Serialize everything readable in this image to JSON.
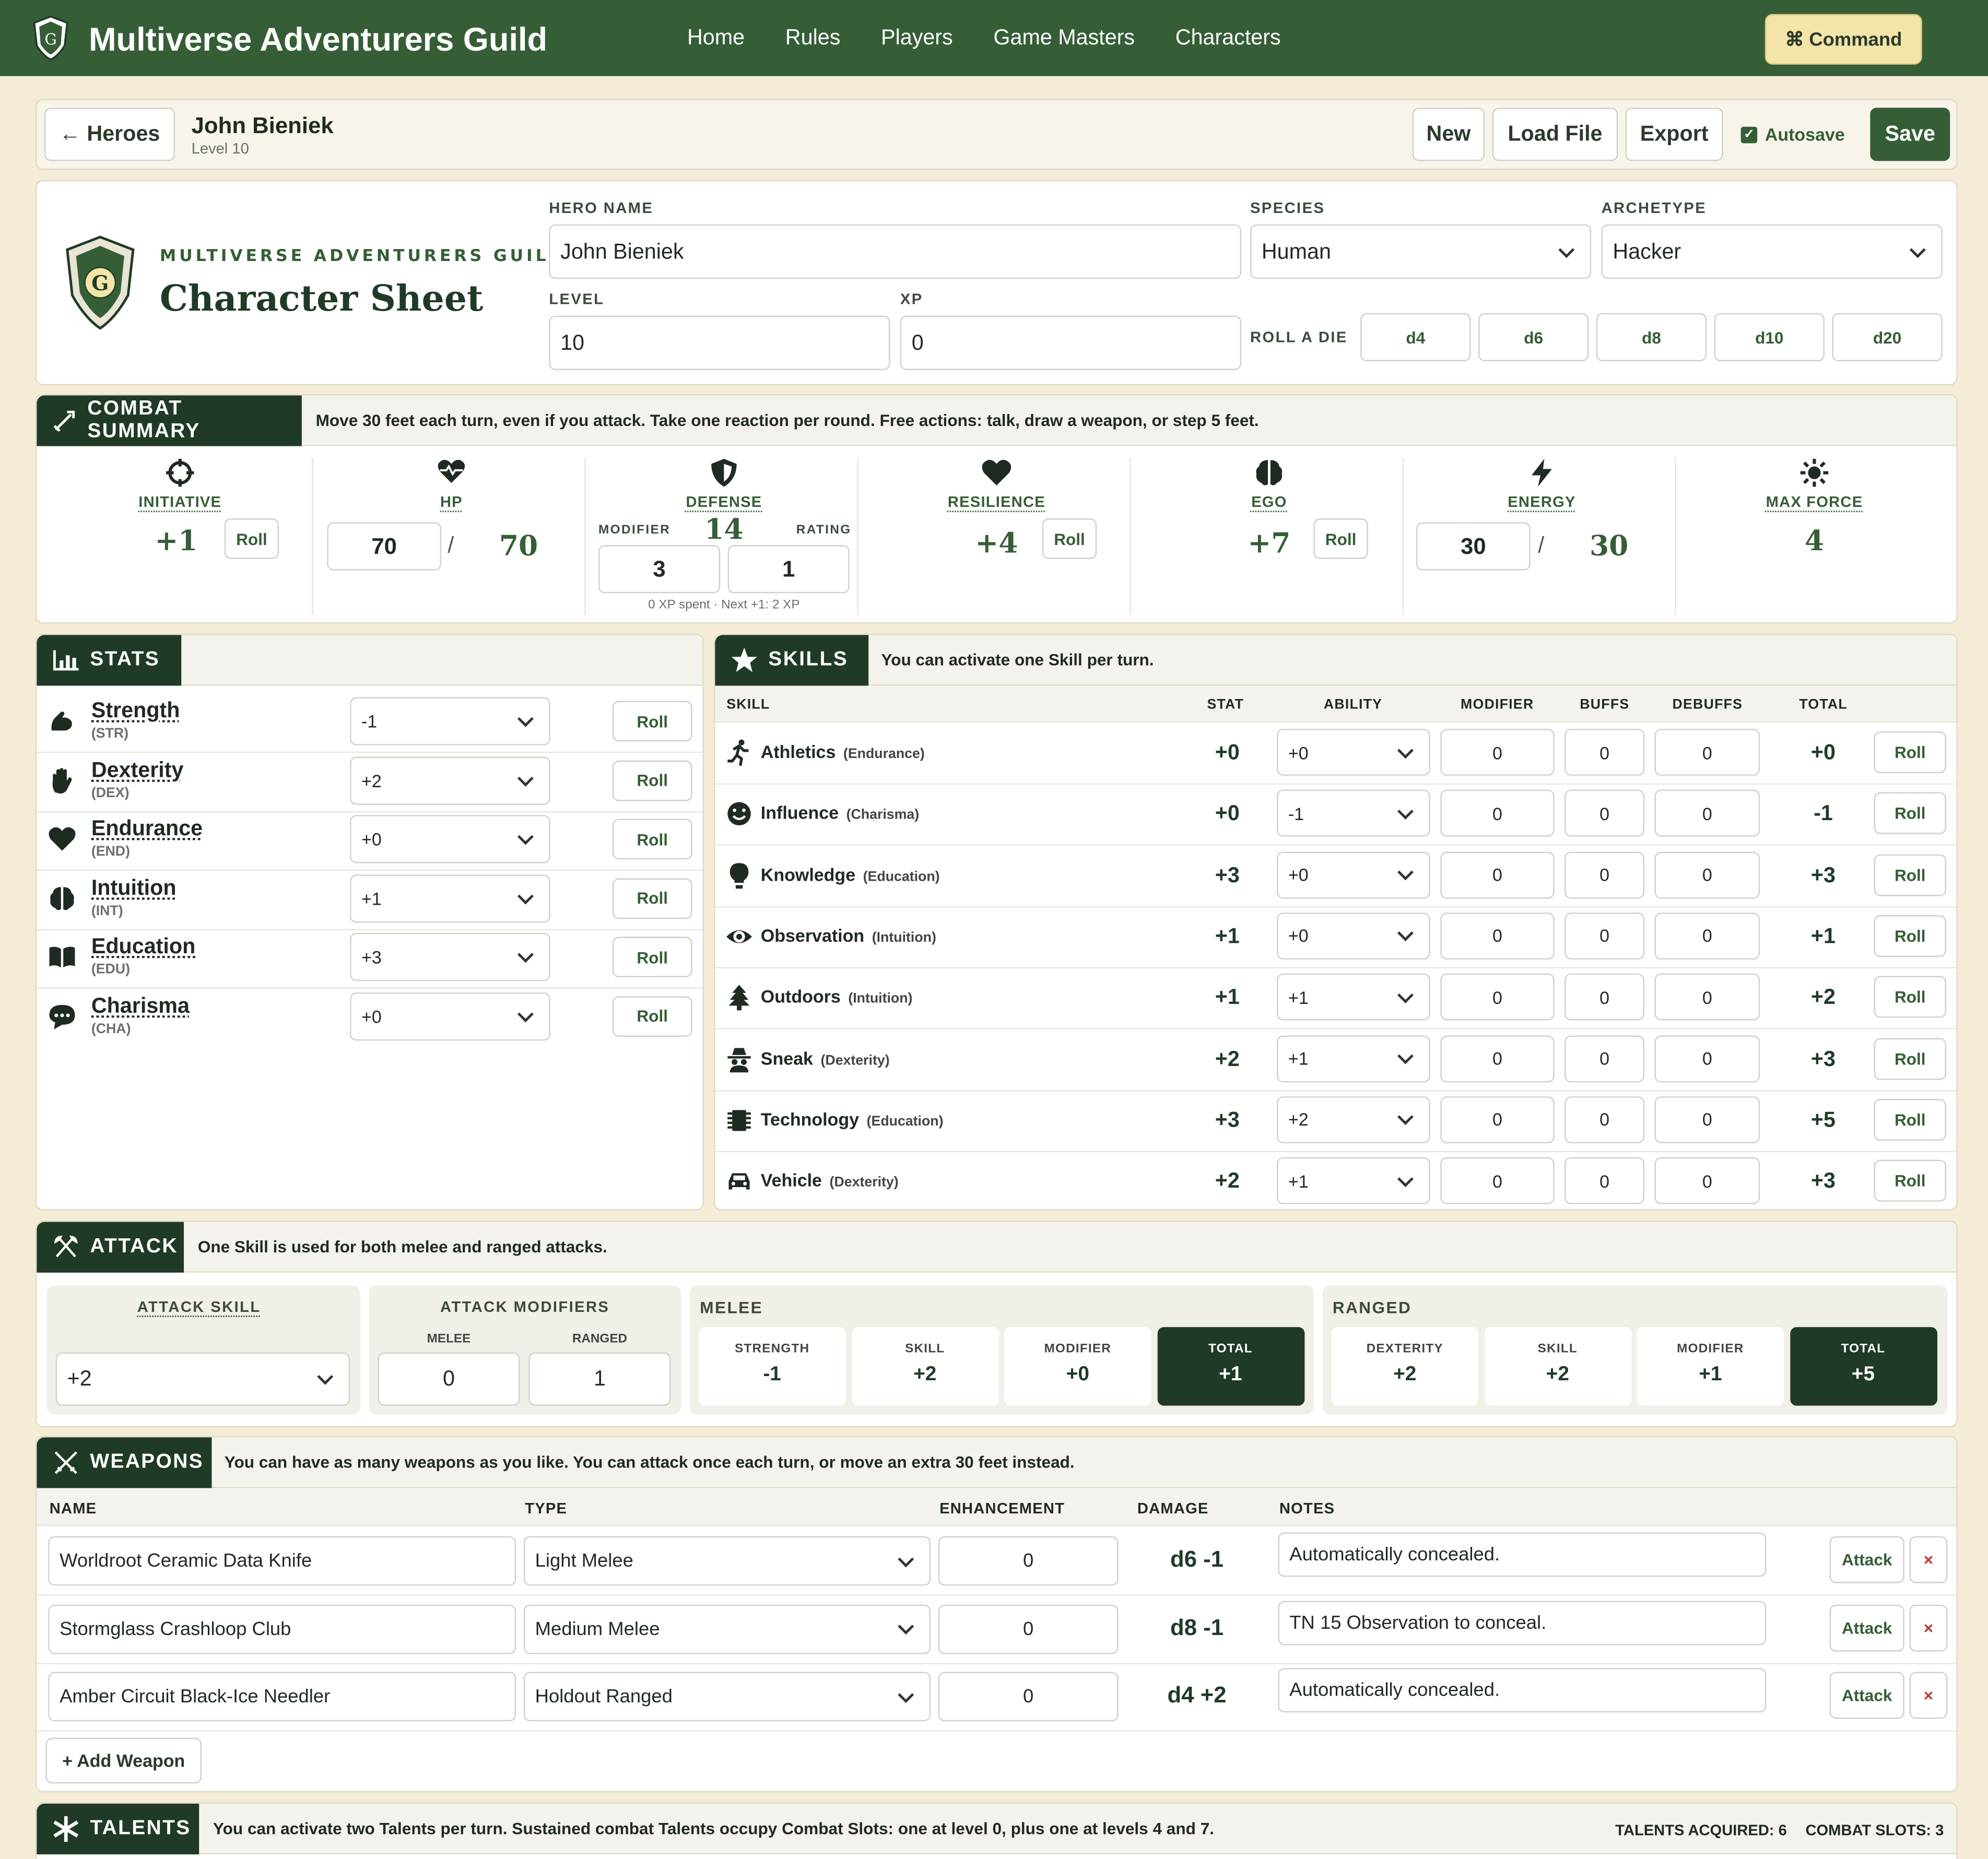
{
  "nav": {
    "brand": "Multiverse Adventurers Guild",
    "links": [
      "Home",
      "Rules",
      "Players",
      "Game Masters",
      "Characters"
    ],
    "command": "Command",
    "colors": {
      "primary": "#355e36",
      "dark": "#1f3b27",
      "background": "#f5ecd7"
    }
  },
  "header": {
    "back": "← Heroes",
    "name": "John Bieniek",
    "level": "Level 10",
    "new": "New",
    "load": "Load File",
    "export": "Export",
    "autosave": "Autosave",
    "save": "Save"
  },
  "sheet": {
    "guild": "MULTIVERSE ADVENTURERS GUILD",
    "title": "Character Sheet",
    "labels": {
      "hero_name": "HERO NAME",
      "species": "SPECIES",
      "archetype": "ARCHETYPE",
      "level": "LEVEL",
      "xp": "XP",
      "roll_die": "ROLL A DIE"
    },
    "hero_name": "John Bieniek",
    "species": "Human",
    "archetype": "Hacker",
    "level": "10",
    "xp": "0",
    "dice": [
      "d4",
      "d6",
      "d8",
      "d10",
      "d20"
    ]
  },
  "combat": {
    "title": "COMBAT SUMMARY",
    "note": "Move 30 feet each turn, even if you attack. Take one reaction per round. Free actions: talk, draw a weapon, or step 5 feet.",
    "roll": "Roll",
    "initiative": {
      "label": "INITIATIVE",
      "value": "+1"
    },
    "hp": {
      "label": "HP",
      "current": "70",
      "max": "70",
      "sep": "/"
    },
    "defense": {
      "label": "DEFENSE",
      "value": "14",
      "modifier_label": "MODIFIER",
      "rating_label": "RATING",
      "modifier": "3",
      "rating": "1",
      "note": "0 XP spent · Next +1: 2 XP"
    },
    "resilience": {
      "label": "RESILIENCE",
      "value": "+4"
    },
    "ego": {
      "label": "EGO",
      "value": "+7"
    },
    "energy": {
      "label": "ENERGY",
      "current": "30",
      "max": "30",
      "sep": "/"
    },
    "max_force": {
      "label": "MAX FORCE",
      "value": "4"
    }
  },
  "stats": {
    "title": "STATS",
    "roll": "Roll",
    "items": [
      {
        "name": "Strength",
        "abbr": "(STR)",
        "value": "-1",
        "icon": "flexed-arm-icon"
      },
      {
        "name": "Dexterity",
        "abbr": "(DEX)",
        "value": "+2",
        "icon": "hand-icon"
      },
      {
        "name": "Endurance",
        "abbr": "(END)",
        "value": "+0",
        "icon": "heart-icon"
      },
      {
        "name": "Intuition",
        "abbr": "(INT)",
        "value": "+1",
        "icon": "brain-icon"
      },
      {
        "name": "Education",
        "abbr": "(EDU)",
        "value": "+3",
        "icon": "book-icon"
      },
      {
        "name": "Charisma",
        "abbr": "(CHA)",
        "value": "+0",
        "icon": "speech-bubble-icon"
      }
    ]
  },
  "skills": {
    "title": "SKILLS",
    "note": "You can activate one Skill per turn.",
    "roll": "Roll",
    "headers": [
      "SKILL",
      "STAT",
      "ABILITY",
      "MODIFIER",
      "BUFFS",
      "DEBUFFS",
      "TOTAL"
    ],
    "rows": [
      {
        "name": "Athletics",
        "stat_name": "(Endurance)",
        "stat": "+0",
        "ability": "+0",
        "modifier": "0",
        "buffs": "0",
        "debuffs": "0",
        "total": "+0",
        "icon": "running-icon"
      },
      {
        "name": "Influence",
        "stat_name": "(Charisma)",
        "stat": "+0",
        "ability": "-1",
        "modifier": "0",
        "buffs": "0",
        "debuffs": "0",
        "total": "-1",
        "icon": "smile-icon"
      },
      {
        "name": "Knowledge",
        "stat_name": "(Education)",
        "stat": "+3",
        "ability": "+0",
        "modifier": "0",
        "buffs": "0",
        "debuffs": "0",
        "total": "+3",
        "icon": "lightbulb-icon"
      },
      {
        "name": "Observation",
        "stat_name": "(Intuition)",
        "stat": "+1",
        "ability": "+0",
        "modifier": "0",
        "buffs": "0",
        "debuffs": "0",
        "total": "+1",
        "icon": "eye-icon"
      },
      {
        "name": "Outdoors",
        "stat_name": "(Intuition)",
        "stat": "+1",
        "ability": "+1",
        "modifier": "0",
        "buffs": "0",
        "debuffs": "0",
        "total": "+2",
        "icon": "tree-icon"
      },
      {
        "name": "Sneak",
        "stat_name": "(Dexterity)",
        "stat": "+2",
        "ability": "+1",
        "modifier": "0",
        "buffs": "0",
        "debuffs": "0",
        "total": "+3",
        "icon": "spy-icon"
      },
      {
        "name": "Technology",
        "stat_name": "(Education)",
        "stat": "+3",
        "ability": "+2",
        "modifier": "0",
        "buffs": "0",
        "debuffs": "0",
        "total": "+5",
        "icon": "chip-icon"
      },
      {
        "name": "Vehicle",
        "stat_name": "(Dexterity)",
        "stat": "+2",
        "ability": "+1",
        "modifier": "0",
        "buffs": "0",
        "debuffs": "0",
        "total": "+3",
        "icon": "car-icon"
      }
    ]
  },
  "attack": {
    "title": "ATTACK",
    "note": "One Skill is used for both melee and ranged attacks.",
    "skill_label": "ATTACK SKILL",
    "skill": "+2",
    "mods_label": "ATTACK MODIFIERS",
    "melee_label": "MELEE",
    "ranged_label": "RANGED",
    "melee_mod": "0",
    "ranged_mod": "1",
    "melee": {
      "title": "MELEE",
      "cells": [
        {
          "t": "STRENGTH",
          "v": "-1"
        },
        {
          "t": "SKILL",
          "v": "+2"
        },
        {
          "t": "MODIFIER",
          "v": "+0"
        },
        {
          "t": "TOTAL",
          "v": "+1"
        }
      ]
    },
    "ranged": {
      "title": "RANGED",
      "cells": [
        {
          "t": "DEXTERITY",
          "v": "+2"
        },
        {
          "t": "SKILL",
          "v": "+2"
        },
        {
          "t": "MODIFIER",
          "v": "+1"
        },
        {
          "t": "TOTAL",
          "v": "+5"
        }
      ]
    }
  },
  "weapons": {
    "title": "WEAPONS",
    "note": "You can have as many weapons as you like. You can attack once each turn, or move an extra 30 feet instead.",
    "headers": [
      "NAME",
      "TYPE",
      "ENHANCEMENT",
      "DAMAGE",
      "NOTES"
    ],
    "attack": "Attack",
    "remove": "×",
    "add": "+ Add Weapon",
    "rows": [
      {
        "name": "Worldroot Ceramic Data Knife",
        "type": "Light Melee",
        "enh": "0",
        "damage": "d6 -1",
        "notes": "Automatically concealed."
      },
      {
        "name": "Stormglass Crashloop Club",
        "type": "Medium Melee",
        "enh": "0",
        "damage": "d8 -1",
        "notes": "TN 15 Observation to conceal."
      },
      {
        "name": "Amber Circuit Black-Ice Needler",
        "type": "Holdout Ranged",
        "enh": "0",
        "damage": "d4 +2",
        "notes": "Automatically concealed."
      }
    ]
  },
  "talents": {
    "title": "TALENTS",
    "note": "You can activate two Talents per turn. Sustained combat Talents occupy Combat Slots: one at level 0, plus one at levels 4 and 7.",
    "acquired": "TALENTS ACQUIRED: 6",
    "slots": "COMBAT SLOTS: 3"
  }
}
